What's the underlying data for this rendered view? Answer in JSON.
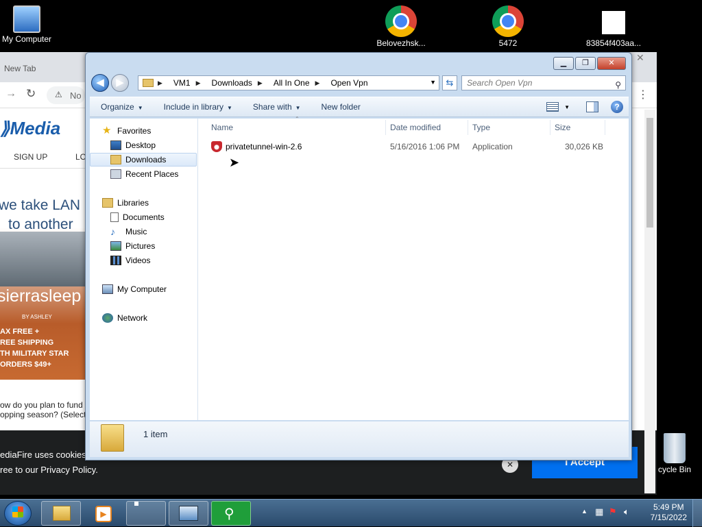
{
  "desktop": {
    "icons": [
      {
        "label": "My Computer"
      },
      {
        "label": "Belovezhsk..."
      },
      {
        "label": "5472"
      },
      {
        "label": "83854f403aa..."
      },
      {
        "label": "cycle Bin"
      }
    ]
  },
  "browser": {
    "tab_label": "New Tab",
    "address_partial": "No",
    "mf_logo": "Media",
    "nav_signup": "SIGN UP",
    "nav_login_partial": "LO",
    "ad_line1": "we take LAN",
    "ad_line2": "to another",
    "ad_brand": "sierrasleep",
    "ad_brand_sub": "BY ASHLEY",
    "ad_promo": [
      "AX FREE +",
      "REE SHIPPING",
      "TH MILITARY STAR",
      "ORDERS $49+"
    ],
    "survey_line1": "ow do you plan to fund",
    "survey_line2": "opping season? (Select",
    "cookie_line1": "ediaFire uses cookies",
    "cookie_line2": "ree to our Privacy Policy.",
    "accept_label": "I Accept"
  },
  "explorer": {
    "breadcrumbs": [
      "VM1",
      "Downloads",
      "All In One",
      "Open Vpn"
    ],
    "search_placeholder": "Search Open Vpn",
    "commands": {
      "organize": "Organize",
      "include": "Include in library",
      "share": "Share with",
      "new_folder": "New folder"
    },
    "navpane": {
      "favorites": "Favorites",
      "desktop": "Desktop",
      "downloads": "Downloads",
      "recent": "Recent Places",
      "libraries": "Libraries",
      "documents": "Documents",
      "music": "Music",
      "pictures": "Pictures",
      "videos": "Videos",
      "computer": "My Computer",
      "network": "Network"
    },
    "columns": {
      "name": "Name",
      "date": "Date modified",
      "type": "Type",
      "size": "Size"
    },
    "files": [
      {
        "name": "privatetunnel-win-2.6",
        "date": "5/16/2016 1:06 PM",
        "type": "Application",
        "size": "30,026 KB"
      }
    ],
    "status": "1 item"
  },
  "taskbar": {
    "time": "5:49 PM",
    "date": "7/15/2022"
  },
  "colors": {
    "accept": "#0070f0",
    "explorer_frame": "#c9dcf0",
    "taskbar": "#2a4a6c"
  }
}
